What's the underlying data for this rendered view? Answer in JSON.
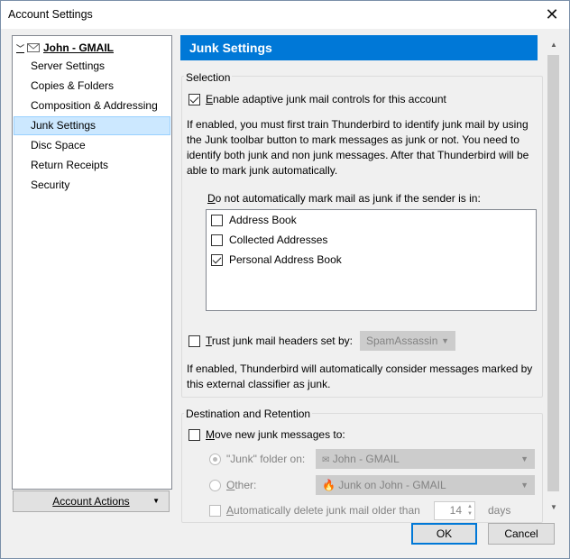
{
  "window": {
    "title": "Account Settings"
  },
  "sidebar": {
    "account": "John - GMAIL",
    "items": [
      {
        "label": "Server Settings"
      },
      {
        "label": "Copies & Folders"
      },
      {
        "label": "Composition & Addressing"
      },
      {
        "label": "Junk Settings",
        "selected": true
      },
      {
        "label": "Disc Space"
      },
      {
        "label": "Return Receipts"
      },
      {
        "label": "Security"
      }
    ],
    "actions_label": "Account Actions"
  },
  "panel": {
    "header": "Junk Settings",
    "selection": {
      "group_label": "Selection",
      "enable_label": "Enable adaptive junk mail controls for this account",
      "enable_checked": true,
      "description": "If enabled, you must first train Thunderbird to identify junk mail by using the Junk toolbar button to mark messages as junk or not. You need to identify both junk and non junk messages. After that Thunderbird will be able to mark junk automatically.",
      "whitelist_label": "Do not automatically mark mail as junk if the sender is in:",
      "whitelist": [
        {
          "label": "Address Book",
          "checked": false
        },
        {
          "label": "Collected Addresses",
          "checked": false
        },
        {
          "label": "Personal Address Book",
          "checked": true
        }
      ],
      "trust_label": "Trust junk mail headers set by:",
      "trust_checked": false,
      "trust_value": "SpamAssassin",
      "trust_description": "If enabled, Thunderbird will automatically consider messages marked by this external classifier as junk."
    },
    "destination": {
      "group_label": "Destination and Retention",
      "move_label": "Move new junk messages to:",
      "move_checked": false,
      "junk_folder_label": "\"Junk\" folder on:",
      "junk_folder_value": "John - GMAIL",
      "other_label": "Other:",
      "other_value": "Junk on John - GMAIL",
      "auto_delete_label": "Automatically delete junk mail older than",
      "auto_delete_days": "14",
      "days_label": "days"
    }
  },
  "footer": {
    "ok_label": "OK",
    "cancel_label": "Cancel"
  },
  "colors": {
    "accent": "#0078d7",
    "selection": "#cce8ff"
  }
}
